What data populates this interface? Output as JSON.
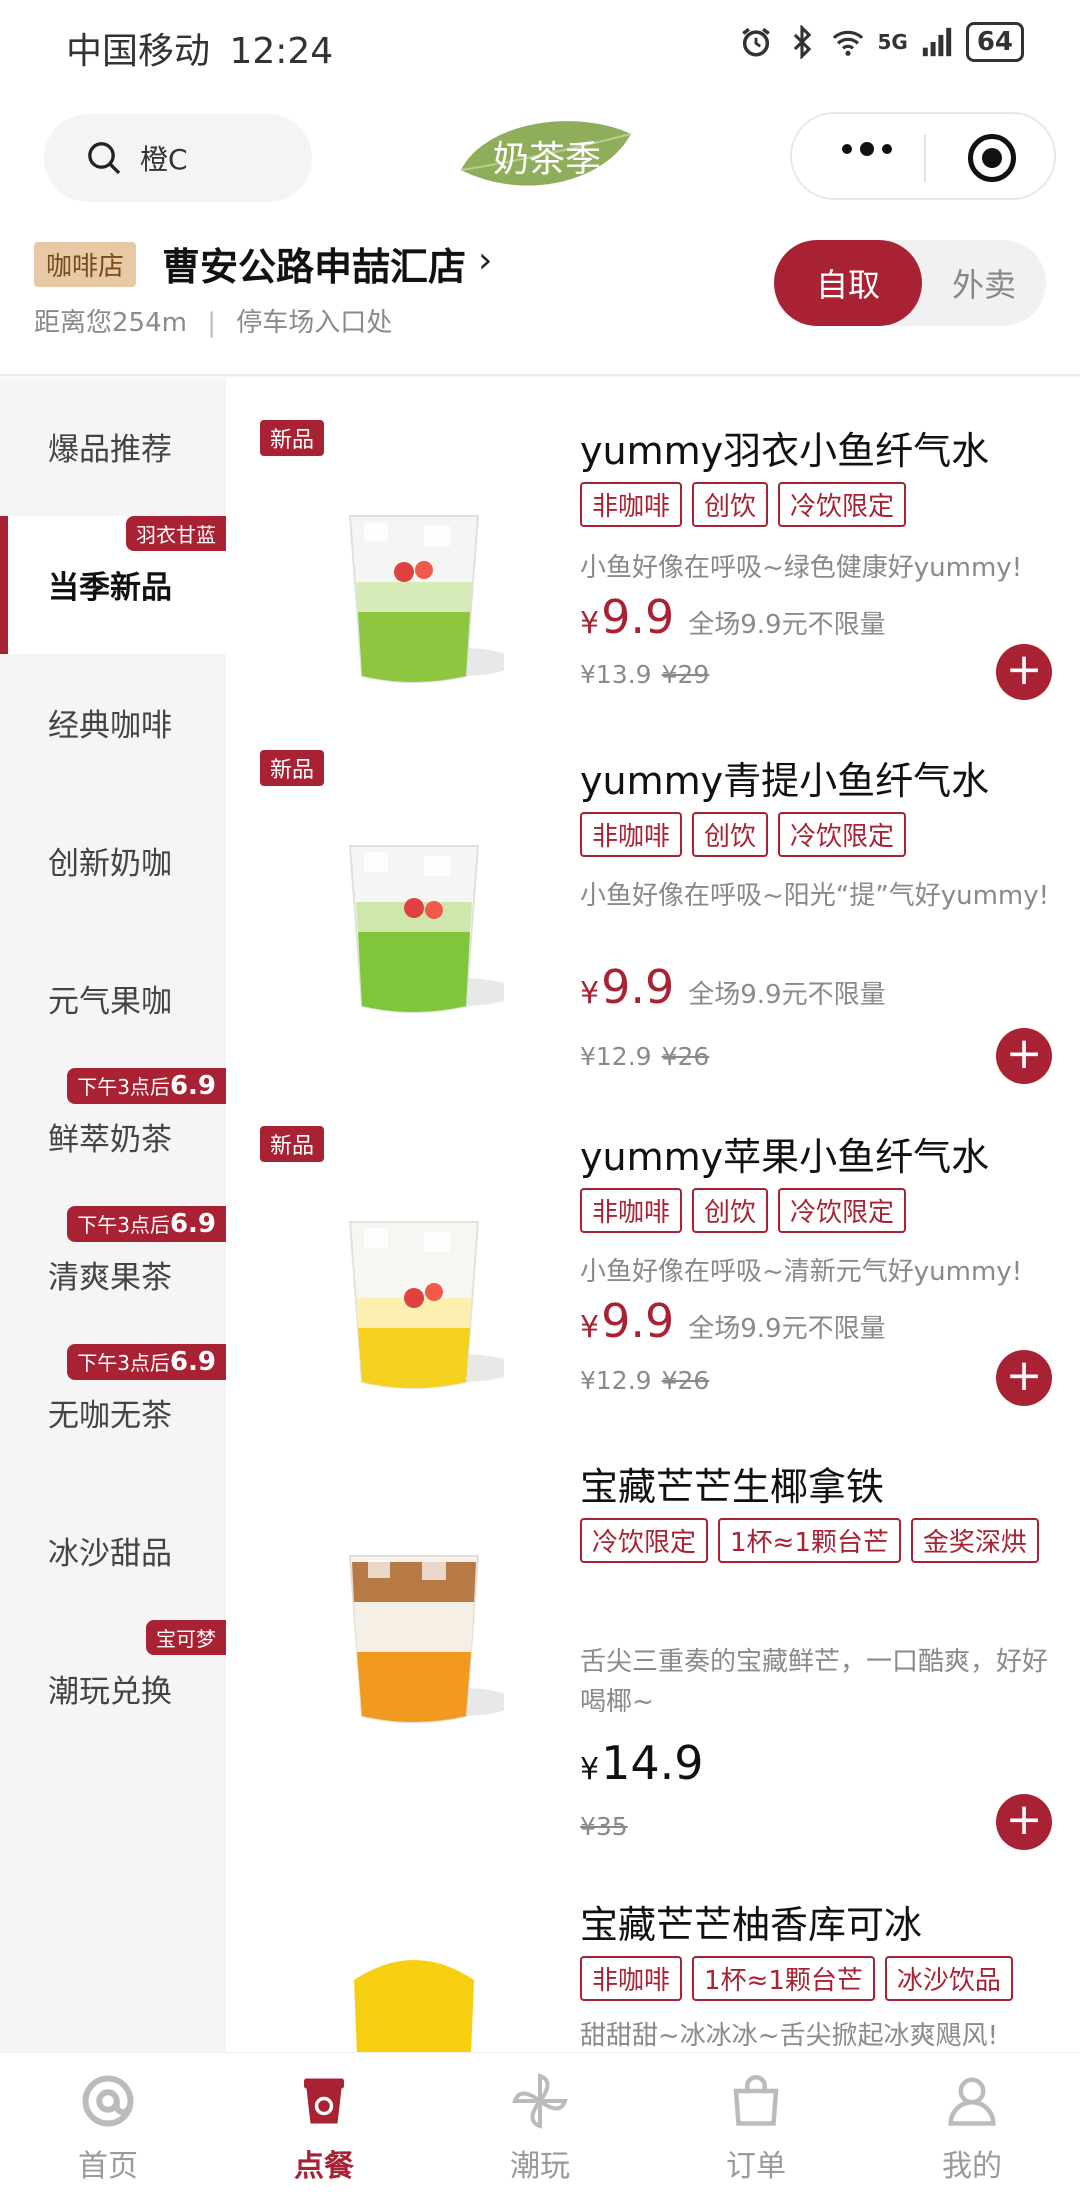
{
  "status_bar": {
    "carrier": "中国移动",
    "time": "12:24",
    "network": "5G",
    "battery": "64"
  },
  "header": {
    "search_text": "橙C",
    "logo_text": "奶茶季"
  },
  "store": {
    "tag": "咖啡店",
    "name": "曹安公路申喆汇店",
    "distance": "距离您254m",
    "location": "停车场入口处",
    "mode_active": "自取",
    "mode_inactive": "外卖"
  },
  "sidebar": {
    "items": [
      {
        "label": "爆品推荐",
        "badge": ""
      },
      {
        "label": "当季新品",
        "badge": "羽衣甘蓝"
      },
      {
        "label": "经典咖啡",
        "badge": ""
      },
      {
        "label": "创新奶咖",
        "badge": ""
      },
      {
        "label": "元气果咖",
        "badge": ""
      },
      {
        "label": "鲜萃奶茶",
        "badge": "下午3点后",
        "badge_num": "6.9"
      },
      {
        "label": "清爽果茶",
        "badge": "下午3点后",
        "badge_num": "6.9"
      },
      {
        "label": "无咖无茶",
        "badge": "下午3点后",
        "badge_num": "6.9"
      },
      {
        "label": "冰沙甜品",
        "badge": ""
      },
      {
        "label": "潮玩兑换",
        "badge": "宝可梦"
      }
    ]
  },
  "products": [
    {
      "new": "新品",
      "title": "yummy羽衣小鱼纤气水",
      "tags": [
        "非咖啡",
        "创饮",
        "冷饮限定"
      ],
      "desc": "小鱼好像在呼吸~绿色健康好yummy!",
      "yen": "¥",
      "price": "9.9",
      "promo": "全场9.9元不限量",
      "member_price": "¥13.9",
      "orig_price": "¥29"
    },
    {
      "new": "新品",
      "title": "yummy青提小鱼纤气水",
      "tags": [
        "非咖啡",
        "创饮",
        "冷饮限定"
      ],
      "desc": "小鱼好像在呼吸~阳光“提”气好yummy!",
      "yen": "¥",
      "price": "9.9",
      "promo": "全场9.9元不限量",
      "member_price": "¥12.9",
      "orig_price": "¥26"
    },
    {
      "new": "新品",
      "title": "yummy苹果小鱼纤气水",
      "tags": [
        "非咖啡",
        "创饮",
        "冷饮限定"
      ],
      "desc": "小鱼好像在呼吸~清新元气好yummy!",
      "yen": "¥",
      "price": "9.9",
      "promo": "全场9.9元不限量",
      "member_price": "¥12.9",
      "orig_price": "¥26"
    },
    {
      "new": "",
      "title": "宝藏芒芒生椰拿铁",
      "tags": [
        "冷饮限定",
        "1杯≈1颗台芒",
        "金奖深烘"
      ],
      "desc": "舌尖三重奏的宝藏鲜芒，一口酷爽，好好喝椰~",
      "yen": "¥",
      "price": "14.9",
      "promo": "",
      "member_price": "",
      "orig_price": "¥35"
    },
    {
      "new": "",
      "title": "宝藏芒芒柚香库可冰",
      "tags": [
        "非咖啡",
        "1杯≈1颗台芒",
        "冰沙饮品"
      ],
      "desc": "甜甜甜~冰冰冰~舌尖掀起冰爽飓风!",
      "yen": "",
      "price": "",
      "promo": "",
      "member_price": "",
      "orig_price": ""
    }
  ],
  "bottom_nav": [
    {
      "label": "首页",
      "icon": "at-icon"
    },
    {
      "label": "点餐",
      "icon": "cup-icon"
    },
    {
      "label": "潮玩",
      "icon": "pinwheel-icon"
    },
    {
      "label": "订单",
      "icon": "bag-icon"
    },
    {
      "label": "我的",
      "icon": "person-icon"
    }
  ],
  "colors": {
    "brand": "#a82234",
    "tag_bg": "#e7c9a5",
    "sidebar_bg": "#f5f5f5"
  }
}
